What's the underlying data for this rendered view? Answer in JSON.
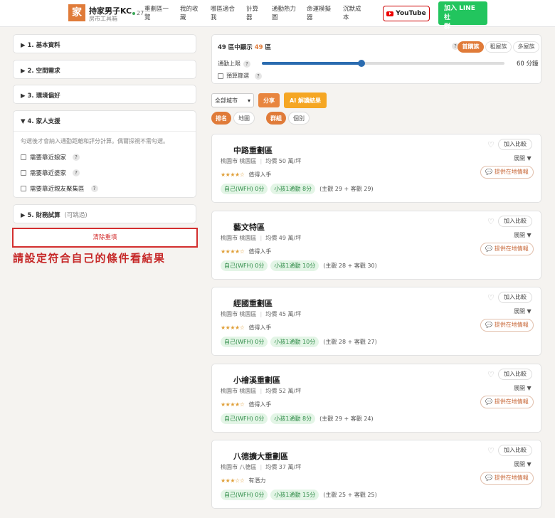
{
  "header": {
    "logo_char": "家",
    "title": "持家男子KC",
    "subtitle": "房市工具箱",
    "online_count": "27",
    "nav": [
      {
        "l1": "重劃區一",
        "l2": "覽"
      },
      {
        "l1": "我的收",
        "l2": "藏"
      },
      {
        "l1": "哪區適合",
        "l2": "我"
      },
      {
        "l1": "計算",
        "l2": "器"
      },
      {
        "l1": "通勤熱力",
        "l2": "圖"
      },
      {
        "l1": "命運模擬",
        "l2": "器"
      },
      {
        "l1": "沉默成",
        "l2": "本"
      }
    ],
    "youtube_label": "YouTube",
    "line_l1": "加入 LINE 社",
    "line_l2": "群"
  },
  "left": {
    "sections": [
      {
        "title": "▶ 1. 基本資料"
      },
      {
        "title": "▶ 2. 空間需求"
      },
      {
        "title": "▶ 3. 環境偏好"
      }
    ],
    "family": {
      "title": "▼ 4. 家人支援",
      "hint": "勾選後才會納入通勤距離和評分計算。偶爾探視不需勾選。",
      "options": [
        "需要靠近娘家",
        "需要靠近婆家",
        "需要靠近親友聚集區"
      ]
    },
    "finance": {
      "title": "▶ 5. 財務試算",
      "optional": "(可跳過)"
    },
    "clear_label": "清除重填",
    "annotation": "請設定符合自己的條件看結果"
  },
  "filter": {
    "count_prefix": "49 區中顯示 ",
    "count_shown": "49",
    "count_suffix": " 區",
    "groups": [
      {
        "label": "首購族",
        "active": true
      },
      {
        "label": "租屋族",
        "active": false
      },
      {
        "label": "多屋族",
        "active": false
      }
    ],
    "commute_label": "通勤上限",
    "commute_value": "60 分鐘",
    "commute_fraction": 0.41,
    "budget_label": "預算篩選"
  },
  "controls": {
    "city_select": "全部城市",
    "share_label": "分享",
    "ai_label": "AI 解讀結果",
    "sort_tabs": [
      {
        "label": "排名",
        "active": true
      },
      {
        "label": "地圖",
        "active": false
      }
    ],
    "view_tabs": [
      {
        "label": "群組",
        "active": true
      },
      {
        "label": "個別",
        "active": false
      }
    ]
  },
  "icons": {
    "help": "question-icon",
    "heart": "heart-icon",
    "chevron": "chevron-down-icon",
    "chat": "chat-icon"
  },
  "card_labels": {
    "compare": "加入比較",
    "expand": "展開",
    "info": "提供在地情報"
  },
  "results": [
    {
      "name": "中路重劃區",
      "city": "桃園市 桃園區",
      "price": "均價 50 萬/坪",
      "stars": "★★★★☆",
      "verdict": "值得入手",
      "tag1": "自己(WFH) 0分",
      "tag2": "小孩1通勤 8分",
      "score": "(主觀 29 + 客觀 29)"
    },
    {
      "name": "藝文特區",
      "city": "桃園市 桃園區",
      "price": "均價 49 萬/坪",
      "stars": "★★★★☆",
      "verdict": "值得入手",
      "tag1": "自己(WFH) 0分",
      "tag2": "小孩1通勤 10分",
      "score": "(主觀 28 + 客觀 30)"
    },
    {
      "name": "經國重劃區",
      "city": "桃園市 桃園區",
      "price": "均價 45 萬/坪",
      "stars": "★★★★☆",
      "verdict": "值得入手",
      "tag1": "自己(WFH) 0分",
      "tag2": "小孩1通勤 10分",
      "score": "(主觀 28 + 客觀 27)"
    },
    {
      "name": "小檜溪重劃區",
      "city": "桃園市 桃園區",
      "price": "均價 52 萬/坪",
      "stars": "★★★★☆",
      "verdict": "值得入手",
      "tag1": "自己(WFH) 0分",
      "tag2": "小孩1通勤 8分",
      "score": "(主觀 29 + 客觀 24)"
    },
    {
      "name": "八德擴大重劃區",
      "city": "桃園市 八德區",
      "price": "均價 37 萬/坪",
      "stars": "★★★☆☆",
      "verdict": "有潛力",
      "tag1": "自己(WFH) 0分",
      "tag2": "小孩1通勤 15分",
      "score": "(主觀 25 + 客觀 25)"
    }
  ]
}
